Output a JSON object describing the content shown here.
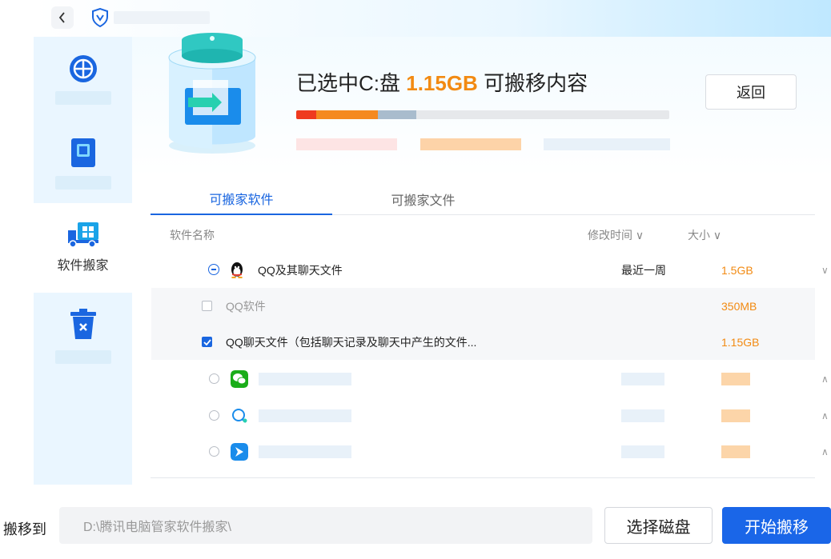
{
  "header": {
    "back_icon": "chevron-left-icon",
    "logo_icon": "shield-logo-icon"
  },
  "sidebar": {
    "items": [
      {
        "icon": "clean-icon",
        "label": ""
      },
      {
        "icon": "disk-icon",
        "label": ""
      },
      {
        "icon": "truck-icon",
        "label": "软件搬家",
        "active": true
      },
      {
        "icon": "trash-icon",
        "label": ""
      }
    ]
  },
  "summary": {
    "prefix": "已选中C:盘 ",
    "size": "1.15GB",
    "suffix": " 可搬移内容",
    "return_label": "返回",
    "bar_segments": [
      {
        "fraction": 0.053,
        "color": "#ef3a1f"
      },
      {
        "fraction": 0.165,
        "color": "#f5891f"
      },
      {
        "fraction": 0.105,
        "color": "#a9bccd"
      }
    ]
  },
  "tabs": [
    {
      "label": "可搬家软件",
      "active": true
    },
    {
      "label": "可搬家文件",
      "active": false
    }
  ],
  "columns": {
    "name": "软件名称",
    "time": "修改时间",
    "size": "大小"
  },
  "rows": {
    "qq": {
      "name": "QQ及其聊天文件",
      "time": "最近一周",
      "size": "1.5GB"
    },
    "qq_software": {
      "name": "QQ软件",
      "size": "350MB",
      "checked": false
    },
    "qq_chat": {
      "name": "QQ聊天文件（包括聊天记录及聊天中产生的文件...",
      "size": "1.15GB",
      "checked": true
    }
  },
  "placeholder_rows": [
    {
      "icon": "wechat-icon",
      "color": "#1aad19"
    },
    {
      "icon": "chat-bubble-icon",
      "color": "#ffffff"
    },
    {
      "icon": "file-send-icon",
      "color": "#1a8ceb"
    }
  ],
  "footer": {
    "label": "搬移到",
    "path": "D:\\腾讯电脑管家软件搬家\\",
    "select_disk": "选择磁盘",
    "start": "开始搬移"
  },
  "colors": {
    "accent": "#1a66e0",
    "size_orange": "#f28a12"
  }
}
